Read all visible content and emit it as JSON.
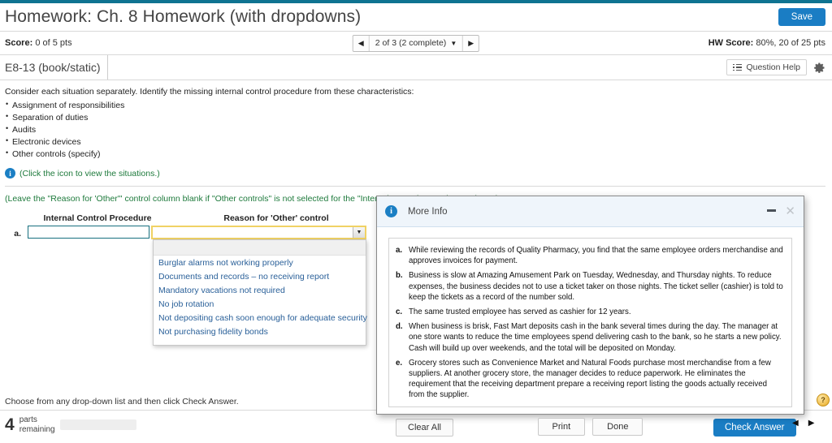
{
  "header": {
    "title": "Homework: Ch. 8 Homework (with dropdowns)",
    "save_label": "Save"
  },
  "score_bar": {
    "score_label": "Score:",
    "score_value": "0 of 5 pts",
    "pager_text": "2 of 3 (2 complete)",
    "prev_icon": "◀",
    "next_icon": "▶",
    "caret_icon": "▼",
    "hw_score_label": "HW Score:",
    "hw_score_value": "80%, 20 of 25 pts"
  },
  "exercise": {
    "tab_label": "E8-13 (book/static)",
    "question_help_label": "Question Help",
    "gear_icon": "gear-icon"
  },
  "problem": {
    "intro": "Consider each situation separately. Identify the missing internal control procedure from these characteristics:",
    "bullets": [
      "Assignment of responsibilities",
      "Separation of duties",
      "Audits",
      "Electronic devices",
      "Other controls (specify)"
    ],
    "info_icon": "i",
    "info_link": "(Click the icon to view the situations.)",
    "leave_note": "(Leave the \"Reason for 'Other'\" control column blank if \"Other controls\" is not selected for the \"Internal Control Procedure\" column.)"
  },
  "answer_table": {
    "col1_header": "Internal Control Procedure",
    "col2_header": "Reason for 'Other' control",
    "row_label": "a.",
    "icp_value": "",
    "reason_value": "",
    "dropdown_arrow": "▼",
    "dropdown_options": [
      "Burglar alarms not working properly",
      "Documents and records – no receiving report",
      "Mandatory vacations not required",
      "No job rotation",
      "Not depositing cash soon enough for adequate security",
      "Not purchasing fidelity bonds"
    ]
  },
  "modal": {
    "title": "More Info",
    "info_icon": "i",
    "minimize_icon": "minimize-icon",
    "close_icon": "✕",
    "situations": [
      {
        "key": "a.",
        "text": "While reviewing the records of Quality Pharmacy, you find that the same employee orders merchandise and approves invoices for payment."
      },
      {
        "key": "b.",
        "text": "Business is slow at Amazing Amusement Park on Tuesday, Wednesday, and Thursday nights. To reduce expenses, the business decides not to use a ticket taker on those nights. The ticket seller (cashier) is told to keep the tickets as a record of the number sold."
      },
      {
        "key": "c.",
        "text": "The same trusted employee has served as cashier for 12 years."
      },
      {
        "key": "d.",
        "text": "When business is brisk, Fast Mart deposits cash in the bank several times during the day. The manager at one store wants to reduce the time employees spend delivering cash to the bank, so he starts a new policy. Cash will build up over weekends, and the total will be deposited on Monday."
      },
      {
        "key": "e.",
        "text": "Grocery stores such as Convenience Market and Natural Foods purchase most merchandise from a few suppliers. At another grocery store, the manager decides to reduce paperwork. He eliminates the requirement that the receiving department prepare a receiving report listing the goods actually received from the supplier."
      }
    ],
    "print_label": "Print",
    "done_label": "Done"
  },
  "footer": {
    "instruction": "Choose from any drop-down list and then click Check Answer.",
    "parts_number": "4",
    "parts_label_line1": "parts",
    "parts_label_line2": "remaining",
    "progress_percent": 20,
    "clear_all_label": "Clear All",
    "check_answer_label": "Check Answer",
    "prev_icon": "◀",
    "next_icon": "▶",
    "help_icon": "?"
  },
  "colors": {
    "accent_blue": "#1a7dc4",
    "top_bar": "#0f7391",
    "green_text": "#1e7a3c",
    "focus_yellow": "#f0d264",
    "input_teal": "#17707f"
  }
}
